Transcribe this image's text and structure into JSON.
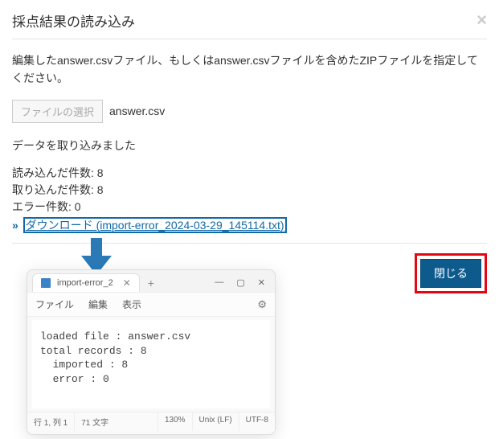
{
  "dialog": {
    "title": "採点結果の読み込み",
    "close_x": "×",
    "instruction": "編集したanswer.csvファイル、もしくはanswer.csvファイルを含めたZIPファイルを指定してください。",
    "file_button": "ファイルの選択",
    "selected_file": "answer.csv",
    "status_message": "データを取り込みました",
    "counts": {
      "read": "読み込んだ件数: 8",
      "imported": "取り込んだ件数: 8",
      "errors": "エラー件数: 0"
    },
    "download_prefix": "»",
    "download_label": "ダウンロード (import-error_2024-03-29_145114.txt)",
    "close_button": "閉じる"
  },
  "notepad": {
    "tab_title": "import-error_2",
    "tab_close": "✕",
    "plus": "+",
    "win_min": "—",
    "win_max": "▢",
    "win_close": "✕",
    "menu": {
      "file": "ファイル",
      "edit": "編集",
      "view": "表示",
      "gear": "⚙"
    },
    "content": "loaded file : answer.csv\ntotal records : 8\n  imported : 8\n  error : 0",
    "status": {
      "pos": "行 1, 列 1",
      "chars": "71 文字",
      "zoom": "130%",
      "eol": "Unix (LF)",
      "enc": "UTF-8"
    }
  }
}
